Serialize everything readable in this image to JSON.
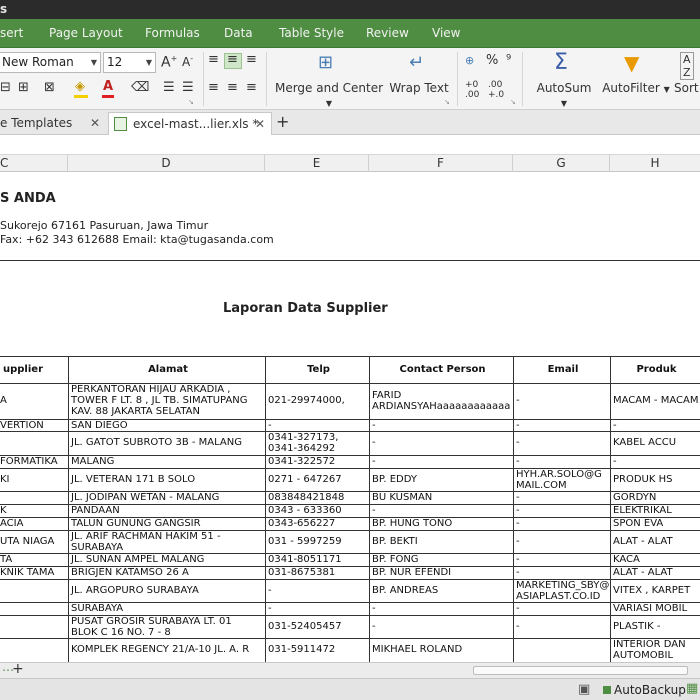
{
  "window": {
    "title_fragment": "s"
  },
  "menu": [
    "sert",
    "Page Layout",
    "Formulas",
    "Data",
    "Table Style",
    "Review",
    "View"
  ],
  "ribbon": {
    "font_name": "New Roman",
    "font_size": "12",
    "merge_center": "Merge and Center",
    "wrap_text": "Wrap Text",
    "autosum": "AutoSum",
    "autofilter": "AutoFilter",
    "sort": "Sort",
    "percent": "%",
    "accent_color": "#4f8d42"
  },
  "tabs": [
    {
      "label": "e Templates"
    },
    {
      "label": "excel-mast...lier.xls *"
    }
  ],
  "columns": [
    "C",
    "D",
    "E",
    "F",
    "G",
    "H"
  ],
  "company": {
    "name": "S ANDA",
    "address": "Sukorejo 67161 Pasuruan, Jawa Timur",
    "contact": "Fax: +62 343 612688 Email: kta@tugasanda.com"
  },
  "report_title": "Laporan Data Supplier",
  "table": {
    "headers": [
      "upplier",
      "Alamat",
      "Telp",
      "Contact Person",
      "Email",
      "Produk"
    ],
    "rows": [
      [
        "A",
        "PERKANTORAN HIJAU ARKADIA ,\nTOWER F LT. 8 , JL TB. SIMATUPANG\nKAV. 88 JAKARTA SELATAN",
        "021-29974000,",
        "FARID\nARDIANSYAHaaaaaaaaaaaa",
        "-",
        "MACAM - MACAM"
      ],
      [
        "VERTION",
        "SAN DIEGO",
        "-",
        "-",
        "-",
        "-"
      ],
      [
        "",
        "JL. GATOT SUBROTO 3B - MALANG",
        "0341-327173,\n0341-364292",
        "-",
        "-",
        "KABEL ACCU"
      ],
      [
        "FORMATIKA",
        "MALANG",
        "0341-322572",
        "-",
        "-",
        "-"
      ],
      [
        "KI",
        "JL. VETERAN 171 B SOLO",
        "0271 - 647267",
        "BP. EDDY",
        "HYH.AR.SOLO@G\nMAIL.COM",
        "PRODUK HS"
      ],
      [
        "",
        "JL. JODIPAN WETAN - MALANG",
        "083848421848",
        "BU KUSMAN",
        "-",
        "GORDYN"
      ],
      [
        "K",
        "PANDAAN",
        "0343 - 633360",
        "-",
        "-",
        "ELEKTRIKAL"
      ],
      [
        "ACIA",
        "TALUN GUNUNG GANGSIR",
        "0343-656227",
        "BP. HUNG TONO",
        "-",
        "SPON EVA"
      ],
      [
        "UTA NIAGA",
        "JL. ARIF RACHMAN HAKIM 51 -\nSURABAYA",
        "031 - 5997259",
        "BP. BEKTI",
        "-",
        "ALAT - ALAT TEHN"
      ],
      [
        "TA",
        "JL. SUNAN AMPEL MALANG",
        "0341-8051171",
        "BP. FONG",
        "-",
        "KACA"
      ],
      [
        "KNIK TAMA",
        "BRIGJEN KATAMSO 26 A",
        "031-8675381",
        "BP. NUR EFENDI",
        "-",
        "ALAT - ALAT TEHN"
      ],
      [
        "",
        "JL. ARGOPURO SURABAYA",
        "-",
        "BP. ANDREAS",
        "MARKETING_SBY@\nASIAPLAST.CO.ID",
        "VITEX , KARPET A"
      ],
      [
        "",
        "SURABAYA",
        "-",
        "-",
        "-",
        "VARIASI MOBIL"
      ],
      [
        "",
        "PUSAT GROSIR SURABAYA LT. 01\nBLOK C 16 NO. 7 - 8",
        "031-52405457",
        "-",
        "-",
        "PLASTIK - PLASTIK"
      ],
      [
        "",
        "KOMPLEK REGENCY 21/A-10 JL. A. R",
        "031-5911472",
        "MIKHAEL ROLAND",
        "",
        "INTERIOR DAN\nAUTOMOBIL"
      ]
    ]
  },
  "status": {
    "autobackup": "AutoBackup"
  }
}
